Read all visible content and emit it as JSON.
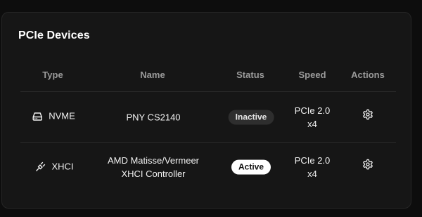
{
  "card": {
    "title": "PCIe Devices"
  },
  "table": {
    "columns": [
      "Type",
      "Name",
      "Status",
      "Speed",
      "Actions"
    ],
    "rows": [
      {
        "type": "NVME",
        "type_icon": "drive-icon",
        "name_line1": "PNY CS2140",
        "name_line2": "",
        "status": "Inactive",
        "speed_line1": "PCIe 2.0",
        "speed_line2": "x4",
        "action_icon": "gear-icon"
      },
      {
        "type": "XHCI",
        "type_icon": "usb-plug-icon",
        "name_line1": "AMD Matisse/Vermeer",
        "name_line2": "XHCI Controller",
        "status": "Active",
        "speed_line1": "PCIe 2.0",
        "speed_line2": "x4",
        "action_icon": "gear-icon"
      }
    ]
  },
  "colors": {
    "background": "#0d0d0d",
    "card": "#161616",
    "active_badge": "#ffffff",
    "inactive_badge": "#2e2e2e"
  }
}
